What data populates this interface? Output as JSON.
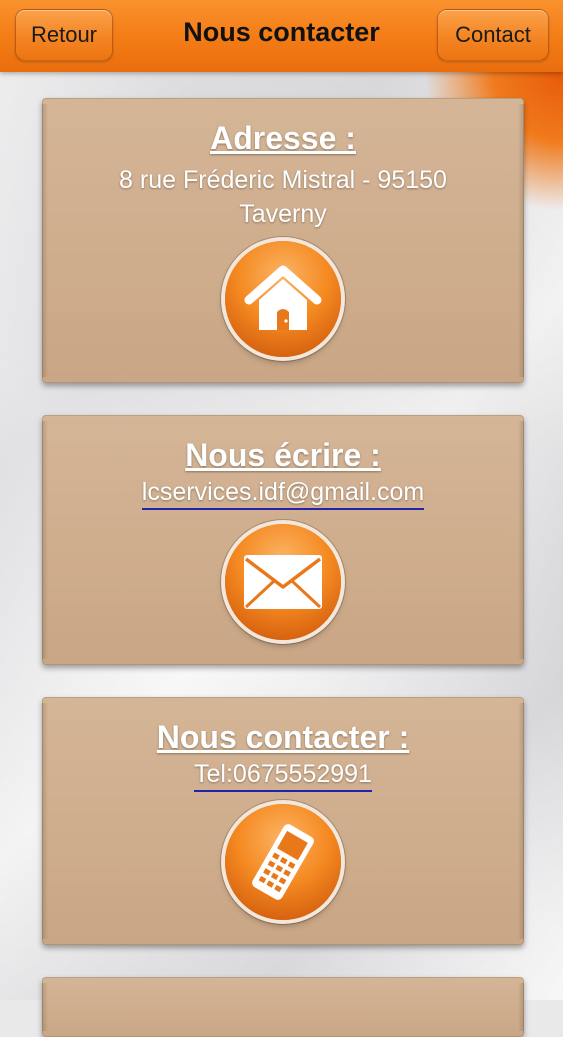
{
  "header": {
    "back_label": "Retour",
    "title": "Nous contacter",
    "contact_label": "Contact"
  },
  "cards": {
    "address": {
      "title": "Adresse :",
      "line1": "8 rue Fréderic Mistral - 95150",
      "line2": "Taverny",
      "icon": "home-icon"
    },
    "email": {
      "title": "Nous écrire :",
      "link": "lcservices.idf@gmail.com",
      "icon": "envelope-icon"
    },
    "phone": {
      "title": "Nous contacter :",
      "link": "Tel:0675552991",
      "icon": "mobile-phone-icon"
    }
  },
  "colors": {
    "header_orange": "#f47d17",
    "card_beige": "#cfae8e",
    "link_underline": "#2222aa"
  }
}
